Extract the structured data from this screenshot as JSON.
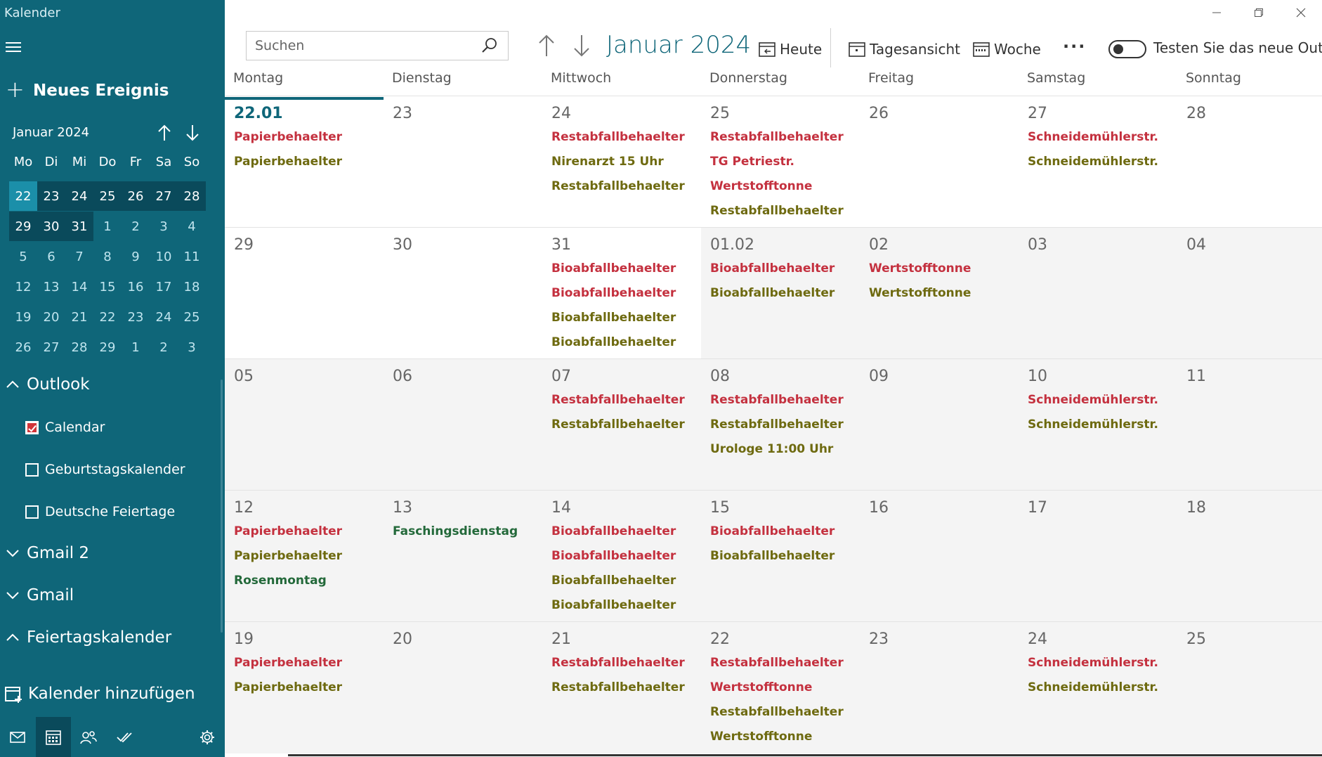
{
  "app": {
    "title": "Kalender"
  },
  "sidebar": {
    "new_event_label": "Neues Ereignis",
    "mini_calendar": {
      "month_label": "Januar 2024",
      "weekday_headers": [
        "Mo",
        "Di",
        "Mi",
        "Do",
        "Fr",
        "Sa",
        "So"
      ],
      "weeks": [
        [
          "22",
          "23",
          "24",
          "25",
          "26",
          "27",
          "28"
        ],
        [
          "29",
          "30",
          "31",
          "1",
          "2",
          "3",
          "4"
        ],
        [
          "5",
          "6",
          "7",
          "8",
          "9",
          "10",
          "11"
        ],
        [
          "12",
          "13",
          "14",
          "15",
          "16",
          "17",
          "18"
        ],
        [
          "19",
          "20",
          "21",
          "22",
          "23",
          "24",
          "25"
        ],
        [
          "26",
          "27",
          "28",
          "29",
          "1",
          "2",
          "3"
        ]
      ]
    },
    "accounts": {
      "outlook": "Outlook",
      "gmail2": "Gmail 2",
      "gmail": "Gmail",
      "holidays": "Feiertagskalender"
    },
    "calendars": {
      "calendar": "Calendar",
      "birthdays": "Geburtstagskalender",
      "german_holidays": "Deutsche Feiertage"
    },
    "add_calendar_label": "Kalender hinzufügen"
  },
  "toolbar": {
    "search_placeholder": "Suchen",
    "title": "Januar 2024",
    "today_label": "Heute",
    "day_view_label": "Tagesansicht",
    "week_label": "Woche",
    "more_label": "···",
    "toggle_label": "Testen Sie das neue Outlook"
  },
  "weekdays": [
    "Montag",
    "Dienstag",
    "Mittwoch",
    "Donnerstag",
    "Freitag",
    "Samstag",
    "Sonntag"
  ],
  "colors": {
    "accent": "#0f6679",
    "event_red": "#c4313f",
    "event_olive": "#6e6a10",
    "event_green": "#23693a"
  },
  "weeks": [
    {
      "days": [
        {
          "num": "22.01",
          "today": true,
          "events": [
            {
              "t": "Papierbehaelter",
              "c": "red"
            },
            {
              "t": "Papierbehaelter",
              "c": "olive"
            }
          ]
        },
        {
          "num": "23",
          "events": []
        },
        {
          "num": "24",
          "events": [
            {
              "t": "Restabfallbehaelter",
              "c": "red"
            },
            {
              "t": "Nirenarzt 15 Uhr",
              "c": "olive"
            },
            {
              "t": "Restabfallbehaelter",
              "c": "olive"
            }
          ]
        },
        {
          "num": "25",
          "events": [
            {
              "t": "Restabfallbehaelter",
              "c": "red"
            },
            {
              "t": "TG Petriestr.",
              "c": "red"
            },
            {
              "t": "Wertstofftonne",
              "c": "red"
            },
            {
              "t": "Restabfallbehaelter",
              "c": "olive"
            }
          ]
        },
        {
          "num": "26",
          "events": []
        },
        {
          "num": "27",
          "events": [
            {
              "t": "Schneidemühlerstr.",
              "c": "red"
            },
            {
              "t": "Schneidemühlerstr.",
              "c": "olive"
            }
          ]
        },
        {
          "num": "28",
          "events": []
        }
      ]
    },
    {
      "days": [
        {
          "num": "29",
          "events": []
        },
        {
          "num": "30",
          "events": []
        },
        {
          "num": "31",
          "events": [
            {
              "t": "Bioabfallbehaelter",
              "c": "red"
            },
            {
              "t": "Bioabfallbehaelter",
              "c": "red"
            },
            {
              "t": "Bioabfallbehaelter",
              "c": "olive"
            },
            {
              "t": "Bioabfallbehaelter",
              "c": "olive"
            }
          ]
        },
        {
          "num": "01.02",
          "future": true,
          "events": [
            {
              "t": "Bioabfallbehaelter",
              "c": "red"
            },
            {
              "t": "Bioabfallbehaelter",
              "c": "olive"
            }
          ]
        },
        {
          "num": "02",
          "future": true,
          "events": [
            {
              "t": "Wertstofftonne",
              "c": "red"
            },
            {
              "t": "Wertstofftonne",
              "c": "olive"
            }
          ]
        },
        {
          "num": "03",
          "future": true,
          "events": []
        },
        {
          "num": "04",
          "future": true,
          "events": []
        }
      ]
    },
    {
      "days": [
        {
          "num": "05",
          "future": true,
          "events": []
        },
        {
          "num": "06",
          "future": true,
          "events": []
        },
        {
          "num": "07",
          "future": true,
          "events": [
            {
              "t": "Restabfallbehaelter",
              "c": "red"
            },
            {
              "t": "Restabfallbehaelter",
              "c": "olive"
            }
          ]
        },
        {
          "num": "08",
          "future": true,
          "events": [
            {
              "t": "Restabfallbehaelter",
              "c": "red"
            },
            {
              "t": "Restabfallbehaelter",
              "c": "olive"
            },
            {
              "t": "Urologe 11:00 Uhr",
              "c": "olive"
            }
          ]
        },
        {
          "num": "09",
          "future": true,
          "events": []
        },
        {
          "num": "10",
          "future": true,
          "events": [
            {
              "t": "Schneidemühlerstr.",
              "c": "red"
            },
            {
              "t": "Schneidemühlerstr.",
              "c": "olive"
            }
          ]
        },
        {
          "num": "11",
          "future": true,
          "events": []
        }
      ]
    },
    {
      "days": [
        {
          "num": "12",
          "future": true,
          "events": [
            {
              "t": "Papierbehaelter",
              "c": "red"
            },
            {
              "t": "Papierbehaelter",
              "c": "olive"
            },
            {
              "t": "Rosenmontag",
              "c": "green"
            }
          ]
        },
        {
          "num": "13",
          "future": true,
          "events": [
            {
              "t": "Faschingsdienstag",
              "c": "green"
            }
          ]
        },
        {
          "num": "14",
          "future": true,
          "events": [
            {
              "t": "Bioabfallbehaelter",
              "c": "red"
            },
            {
              "t": "Bioabfallbehaelter",
              "c": "red"
            },
            {
              "t": "Bioabfallbehaelter",
              "c": "olive"
            },
            {
              "t": "Bioabfallbehaelter",
              "c": "olive"
            }
          ]
        },
        {
          "num": "15",
          "future": true,
          "events": [
            {
              "t": "Bioabfallbehaelter",
              "c": "red"
            },
            {
              "t": "Bioabfallbehaelter",
              "c": "olive"
            }
          ]
        },
        {
          "num": "16",
          "future": true,
          "events": []
        },
        {
          "num": "17",
          "future": true,
          "events": []
        },
        {
          "num": "18",
          "future": true,
          "events": []
        }
      ]
    },
    {
      "days": [
        {
          "num": "19",
          "future": true,
          "events": [
            {
              "t": "Papierbehaelter",
              "c": "red"
            },
            {
              "t": "Papierbehaelter",
              "c": "olive"
            }
          ]
        },
        {
          "num": "20",
          "future": true,
          "events": []
        },
        {
          "num": "21",
          "future": true,
          "events": [
            {
              "t": "Restabfallbehaelter",
              "c": "red"
            },
            {
              "t": "Restabfallbehaelter",
              "c": "olive"
            }
          ]
        },
        {
          "num": "22",
          "future": true,
          "events": [
            {
              "t": "Restabfallbehaelter",
              "c": "red"
            },
            {
              "t": "Wertstofftonne",
              "c": "red"
            },
            {
              "t": "Restabfallbehaelter",
              "c": "olive"
            },
            {
              "t": "Wertstofftonne",
              "c": "olive"
            }
          ]
        },
        {
          "num": "23",
          "future": true,
          "events": []
        },
        {
          "num": "24",
          "future": true,
          "events": [
            {
              "t": "Schneidemühlerstr.",
              "c": "red"
            },
            {
              "t": "Schneidemühlerstr.",
              "c": "olive"
            }
          ]
        },
        {
          "num": "25",
          "future": true,
          "events": []
        }
      ]
    }
  ]
}
